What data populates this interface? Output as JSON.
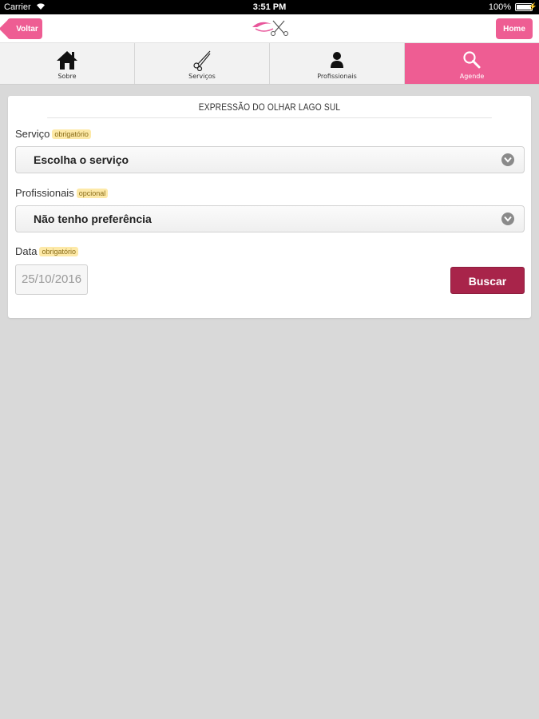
{
  "status_bar": {
    "carrier": "Carrier",
    "time": "3:51 PM",
    "battery": "100%"
  },
  "nav": {
    "back_label": "Voltar",
    "home_label": "Home"
  },
  "tabs": [
    {
      "label": "Sobre",
      "icon": "home-icon"
    },
    {
      "label": "Serviços",
      "icon": "scissors-icon"
    },
    {
      "label": "Profissionais",
      "icon": "person-icon"
    },
    {
      "label": "Agende",
      "icon": "search-icon",
      "active": true
    }
  ],
  "form": {
    "title": "EXPRESSÃO DO OLHAR LAGO SUL",
    "service_label": "Serviço",
    "service_tag": "obrigatório",
    "service_value": "Escolha o serviço",
    "professional_label": "Profissionais",
    "professional_tag": "opcional",
    "professional_value": "Não tenho preferência",
    "date_label": "Data",
    "date_tag": "obrigatório",
    "date_value": "25/10/2016",
    "search_label": "Buscar"
  },
  "colors": {
    "accent": "#ee5d93",
    "button": "#a8244a",
    "background": "#d9d9d9"
  }
}
